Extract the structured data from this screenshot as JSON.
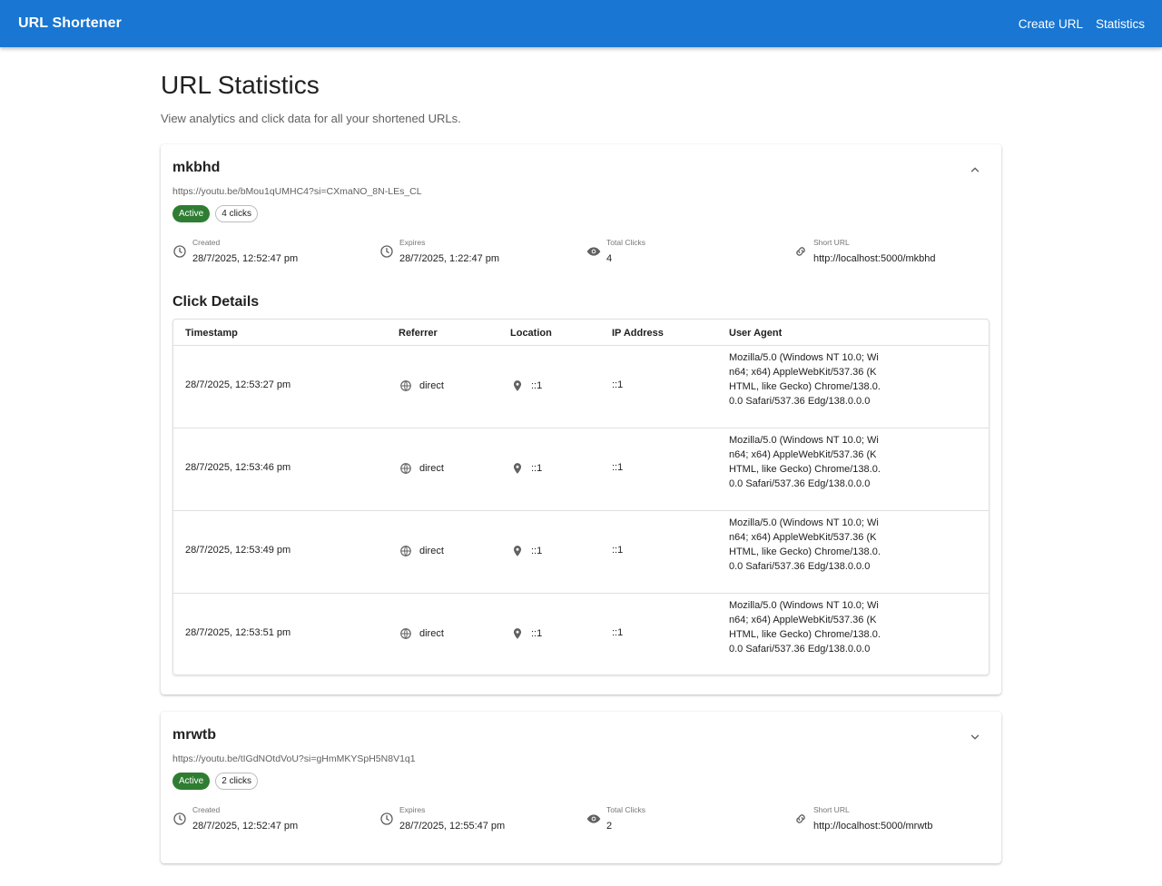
{
  "app": {
    "title": "URL Shortener"
  },
  "nav": {
    "create_label": "Create URL",
    "stats_label": "Statistics"
  },
  "page": {
    "title": "URL Statistics",
    "subtitle": "View analytics and click data for all your shortened URLs."
  },
  "labels": {
    "created": "Created",
    "expires": "Expires",
    "total_clicks": "Total Clicks",
    "short_url": "Short URL",
    "click_details": "Click Details"
  },
  "columns": [
    "Timestamp",
    "Referrer",
    "Location",
    "IP Address",
    "User Agent"
  ],
  "cards": [
    {
      "code": "mkbhd",
      "url": "https://youtu.be/bMou1qUMHC4?si=CXmaNO_8N-LEs_CL",
      "status": "Active",
      "clicks_chip": "4 clicks",
      "created": "28/7/2025, 12:52:47 pm",
      "expires": "28/7/2025, 1:22:47 pm",
      "total_clicks": "4",
      "short_url": "http://localhost:5000/mkbhd",
      "expanded": true,
      "clicks": [
        {
          "timestamp": "28/7/2025, 12:53:27 pm",
          "referrer": "direct",
          "location": "::1",
          "ip": "::1",
          "user_agent": "Mozilla/5.0 (Windows NT 10.0; Win64; x64) AppleWebKit/537.36 (KHTML, like Gecko) Chrome/138.0.0.0 Safari/537.36 Edg/138.0.0.0"
        },
        {
          "timestamp": "28/7/2025, 12:53:46 pm",
          "referrer": "direct",
          "location": "::1",
          "ip": "::1",
          "user_agent": "Mozilla/5.0 (Windows NT 10.0; Win64; x64) AppleWebKit/537.36 (KHTML, like Gecko) Chrome/138.0.0.0 Safari/537.36 Edg/138.0.0.0"
        },
        {
          "timestamp": "28/7/2025, 12:53:49 pm",
          "referrer": "direct",
          "location": "::1",
          "ip": "::1",
          "user_agent": "Mozilla/5.0 (Windows NT 10.0; Win64; x64) AppleWebKit/537.36 (KHTML, like Gecko) Chrome/138.0.0.0 Safari/537.36 Edg/138.0.0.0"
        },
        {
          "timestamp": "28/7/2025, 12:53:51 pm",
          "referrer": "direct",
          "location": "::1",
          "ip": "::1",
          "user_agent": "Mozilla/5.0 (Windows NT 10.0; Win64; x64) AppleWebKit/537.36 (KHTML, like Gecko) Chrome/138.0.0.0 Safari/537.36 Edg/138.0.0.0"
        }
      ]
    },
    {
      "code": "mrwtb",
      "url": "https://youtu.be/tIGdNOtdVoU?si=gHmMKYSpH5N8V1q1",
      "status": "Active",
      "clicks_chip": "2 clicks",
      "created": "28/7/2025, 12:52:47 pm",
      "expires": "28/7/2025, 12:55:47 pm",
      "total_clicks": "2",
      "short_url": "http://localhost:5000/mrwtb",
      "expanded": false
    }
  ],
  "colors": {
    "primary": "#1976d2",
    "active_chip": "#2e7d32"
  },
  "icons": [
    "clock-icon",
    "eye-icon",
    "link-icon",
    "globe-icon",
    "location-pin-icon",
    "chevron-up-icon",
    "chevron-down-icon"
  ]
}
